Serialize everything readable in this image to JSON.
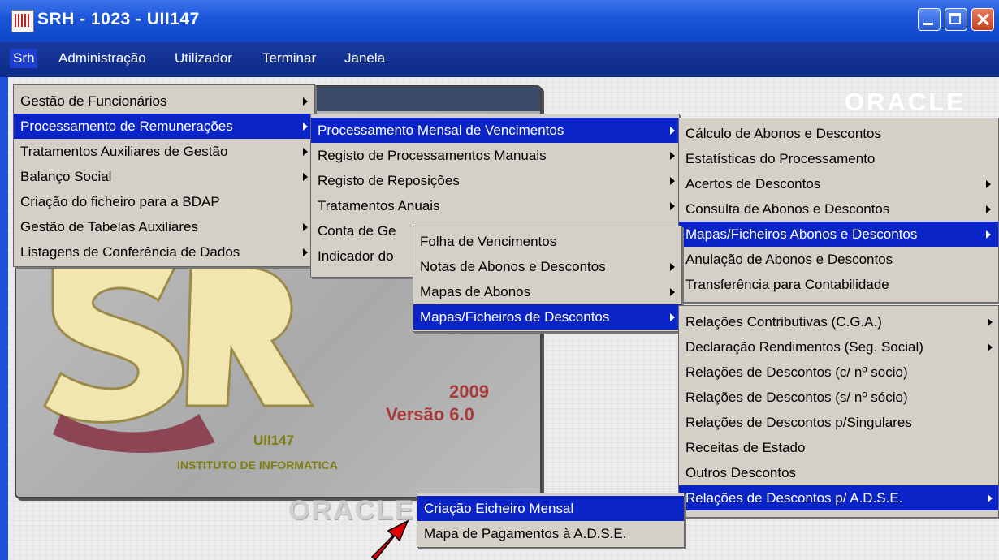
{
  "window": {
    "title": "SRH  - 1023 - UII147"
  },
  "menubar": {
    "items": [
      "Srh",
      "Administração",
      "Utilizador",
      "Terminar",
      "Janela"
    ],
    "brand": "ORACLE"
  },
  "splash": {
    "year": "2009",
    "version": "Versão 6.0",
    "unit_code": "UII147",
    "unit_name": "INSTITUTO DE INFORMATICA",
    "watermark": "ORACLE"
  },
  "menu_srh": {
    "items": [
      {
        "label": "Gestão de Funcionários"
      },
      {
        "label": "Processamento de Remunerações"
      },
      {
        "label": "Tratamentos Auxiliares de Gestão"
      },
      {
        "label": "Balanço Social"
      },
      {
        "label": "Criação do ficheiro para a BDAP"
      },
      {
        "label": "Gestão de Tabelas Auxiliares"
      },
      {
        "label": "Listagens de Conferência de Dados"
      }
    ]
  },
  "menu_processamento": {
    "items": [
      {
        "label": "Processamento Mensal de Vencimentos"
      },
      {
        "label": "Registo de Processamentos Manuais"
      },
      {
        "label": "Registo de Reposições"
      },
      {
        "label": "Tratamentos Anuais"
      },
      {
        "label": "Conta de Ge"
      },
      {
        "label": "Indicador do"
      }
    ]
  },
  "menu_mensal": {
    "items": [
      {
        "label": "Cálculo de Abonos e Descontos"
      },
      {
        "label": "Estatísticas do Processamento"
      },
      {
        "label": "Acertos de Descontos"
      },
      {
        "label": "Consulta de Abonos e Descontos"
      },
      {
        "label": "Mapas/Ficheiros Abonos e Descontos"
      },
      {
        "label": "Anulação de Abonos e Descontos"
      },
      {
        "label": "Transferência para Contabilidade"
      }
    ]
  },
  "menu_mapas_ficheiros": {
    "items": [
      {
        "label": "Folha de Vencimentos"
      },
      {
        "label": "Notas de Abonos e Descontos"
      },
      {
        "label": "Mapas de Abonos"
      },
      {
        "label": "Mapas/Ficheiros de Descontos"
      }
    ]
  },
  "menu_descontos": {
    "items": [
      {
        "label": "Relações Contributivas (C.G.A.)"
      },
      {
        "label": "Declaração Rendimentos (Seg. Social)"
      },
      {
        "label": "Relações de Descontos (c/ nº socio)"
      },
      {
        "label": "Relações de Descontos (s/ nº sócio)"
      },
      {
        "label": "Relações de Descontos p/Singulares"
      },
      {
        "label": "Receitas de Estado"
      },
      {
        "label": "Outros Descontos"
      },
      {
        "label": "Relações de Descontos p/ A.D.S.E."
      }
    ]
  },
  "menu_adse": {
    "items": [
      {
        "label": "Criação Eicheiro Mensal"
      },
      {
        "label": "Mapa de Pagamentos à A.D.S.E."
      }
    ]
  },
  "colors": {
    "selection": "#0a24c8",
    "menu_bg": "#d4d0c8",
    "title_blue": "#1a55d9",
    "pointer": "#e00000"
  },
  "icons": [
    "app-icon",
    "minimize-icon",
    "maximize-icon",
    "close-icon",
    "submenu-arrow-icon",
    "red-arrow-pointer-icon"
  ]
}
